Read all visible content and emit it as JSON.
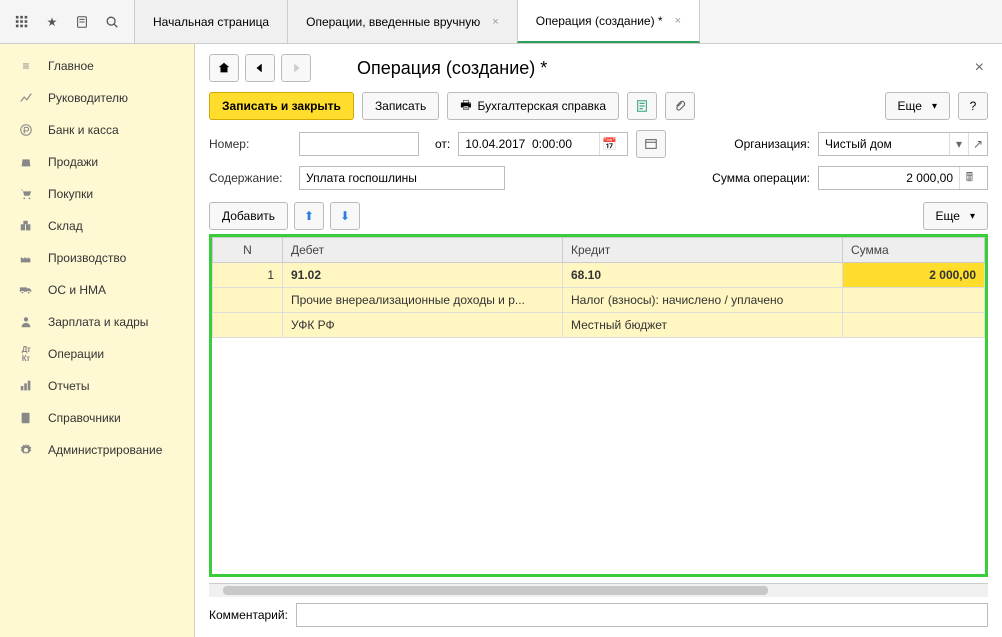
{
  "tabs": {
    "items": [
      {
        "label": "Начальная страница",
        "closable": false,
        "active": false
      },
      {
        "label": "Операции, введенные вручную",
        "closable": true,
        "active": false
      },
      {
        "label": "Операция (создание) *",
        "closable": true,
        "active": true
      }
    ]
  },
  "sidebar": {
    "items": [
      {
        "label": "Главное",
        "icon": "menu"
      },
      {
        "label": "Руководителю",
        "icon": "chart"
      },
      {
        "label": "Банк и касса",
        "icon": "ruble"
      },
      {
        "label": "Продажи",
        "icon": "bag"
      },
      {
        "label": "Покупки",
        "icon": "cart"
      },
      {
        "label": "Склад",
        "icon": "box"
      },
      {
        "label": "Производство",
        "icon": "factory"
      },
      {
        "label": "ОС и НМА",
        "icon": "truck"
      },
      {
        "label": "Зарплата и кадры",
        "icon": "person"
      },
      {
        "label": "Операции",
        "icon": "dkt"
      },
      {
        "label": "Отчеты",
        "icon": "bars"
      },
      {
        "label": "Справочники",
        "icon": "book"
      },
      {
        "label": "Администрирование",
        "icon": "gear"
      }
    ]
  },
  "page": {
    "title": "Операция (создание) *",
    "save_close": "Записать и закрыть",
    "save": "Записать",
    "report": "Бухгалтерская справка",
    "more": "Еще",
    "help": "?",
    "number_label": "Номер:",
    "number_value": "",
    "from_label": "от:",
    "date_value": "10.04.2017  0:00:00",
    "org_label": "Организация:",
    "org_value": "Чистый дом",
    "content_label": "Содержание:",
    "content_value": "Уплата госпошлины",
    "sum_label": "Сумма операции:",
    "sum_value": "2 000,00",
    "add": "Добавить",
    "comment_label": "Комментарий:",
    "comment_value": ""
  },
  "table": {
    "headers": {
      "n": "N",
      "debit": "Дебет",
      "credit": "Кредит",
      "sum": "Сумма"
    },
    "rows": [
      {
        "n": "1",
        "debit_code": "91.02",
        "credit_code": "68.10",
        "sum": "2 000,00",
        "debit_sub1": "Прочие внереализационные доходы и р...",
        "credit_sub1": "Налог (взносы): начислено / уплачено",
        "debit_sub2": "УФК РФ",
        "credit_sub2": "Местный бюджет"
      }
    ]
  }
}
